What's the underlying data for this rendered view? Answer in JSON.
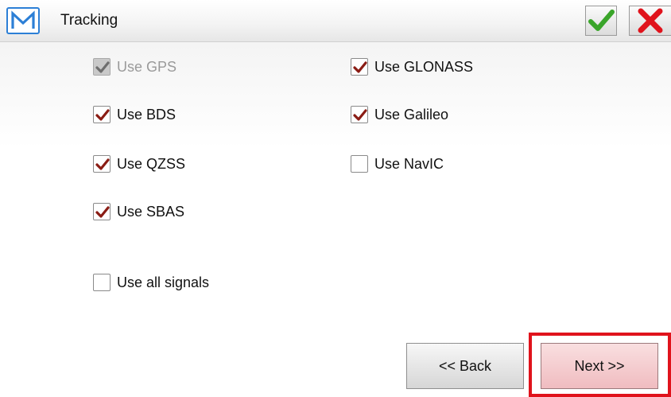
{
  "window": {
    "title": "Tracking",
    "app_icon_letter": "M",
    "ok_icon": "checkmark-icon",
    "cancel_icon": "close-icon",
    "accent_color": "#2c7fd6",
    "ok_color": "#3aa52a",
    "cancel_color": "#e0131c"
  },
  "options": {
    "gps": {
      "label": "Use GPS",
      "checked": true,
      "disabled": true
    },
    "glonass": {
      "label": "Use GLONASS",
      "checked": true,
      "disabled": false
    },
    "bds": {
      "label": "Use BDS",
      "checked": true,
      "disabled": false
    },
    "galileo": {
      "label": "Use Galileo",
      "checked": true,
      "disabled": false
    },
    "qzss": {
      "label": "Use QZSS",
      "checked": true,
      "disabled": false
    },
    "navic": {
      "label": "Use NavIC",
      "checked": false,
      "disabled": false
    },
    "sbas": {
      "label": "Use SBAS",
      "checked": true,
      "disabled": false
    },
    "all_signals": {
      "label": "Use all signals",
      "checked": false,
      "disabled": false
    }
  },
  "buttons": {
    "back_label": "<< Back",
    "next_label": "Next >>"
  }
}
